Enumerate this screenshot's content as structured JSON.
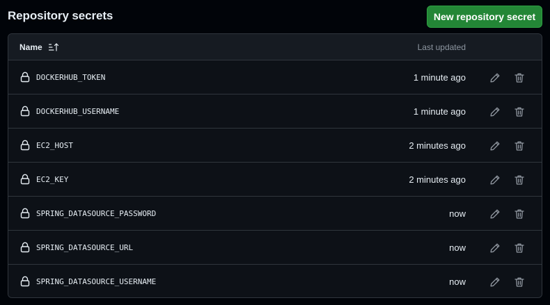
{
  "header": {
    "title": "Repository secrets",
    "new_button_label": "New repository secret"
  },
  "table": {
    "col_name": "Name",
    "col_updated": "Last updated",
    "sort_icon": "sort-ascending-icon",
    "rows": [
      {
        "name": "DOCKERHUB_TOKEN",
        "updated": "1 minute ago"
      },
      {
        "name": "DOCKERHUB_USERNAME",
        "updated": "1 minute ago"
      },
      {
        "name": "EC2_HOST",
        "updated": "2 minutes ago"
      },
      {
        "name": "EC2_KEY",
        "updated": "2 minutes ago"
      },
      {
        "name": "SPRING_DATASOURCE_PASSWORD",
        "updated": "now"
      },
      {
        "name": "SPRING_DATASOURCE_URL",
        "updated": "now"
      },
      {
        "name": "SPRING_DATASOURCE_USERNAME",
        "updated": "now"
      }
    ]
  },
  "icons": {
    "lock": "lock-icon",
    "edit": "pencil-icon",
    "delete": "trash-icon"
  },
  "colors": {
    "background": "#010409",
    "surface": "#0d1117",
    "header_surface": "#161b22",
    "border": "#30363d",
    "primary_button": "#238636",
    "text": "#e6edf3",
    "muted_text": "#8d96a0"
  }
}
